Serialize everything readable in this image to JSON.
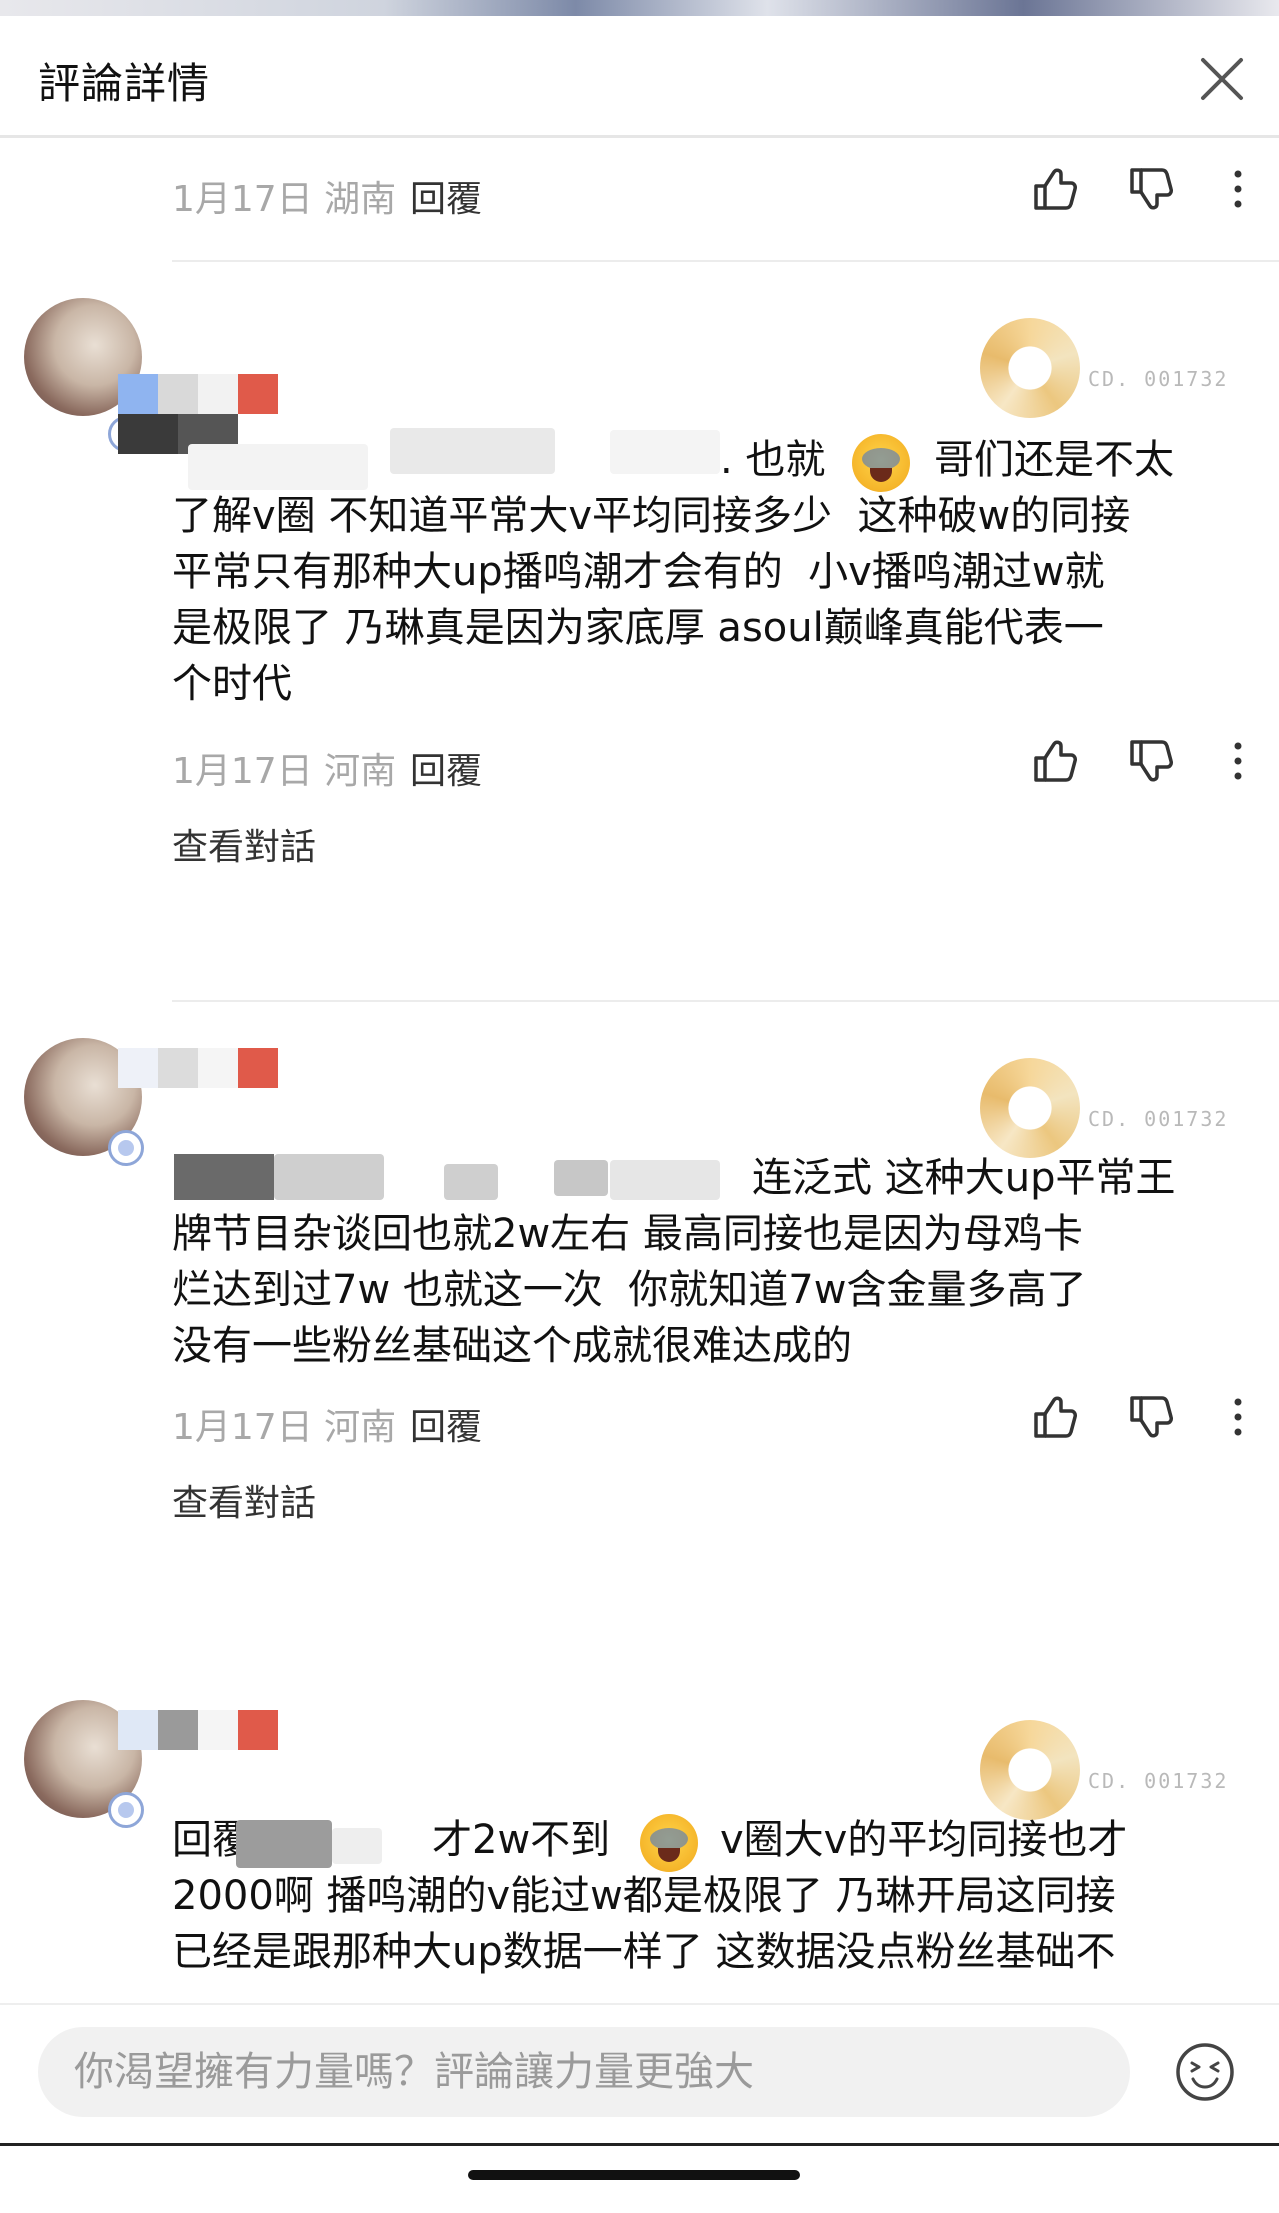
{
  "header": {
    "title": "評論詳情"
  },
  "top_meta": {
    "date": "1月17日",
    "location": "湖南",
    "reply": "回覆"
  },
  "comments": [
    {
      "text_line1_tail": ". 也就",
      "text_line1_after_emoji": "哥们还是不太",
      "text_rest": "了解v圈 不知道平常大v平均同接多少  这种破w的同接\n平常只有那种大up播鸣潮才会有的  小v播鸣潮过w就\n是极限了 乃琳真是因为家底厚 asoul巅峰真能代表一\n个时代",
      "date": "1月17日",
      "location": "河南",
      "reply": "回覆",
      "view_conversation": "查看對話",
      "pendant_code": "CD.\n001732"
    },
    {
      "text_line1_tail": "连泛式 这种大up平常王",
      "text_rest": "牌节目杂谈回也就2w左右 最高同接也是因为母鸡卡\n烂达到过7w 也就这一次  你就知道7w含金量多高了\n没有一些粉丝基础这个成就很难达成的",
      "date": "1月17日",
      "location": "河南",
      "reply": "回覆",
      "view_conversation": "查看對話",
      "pendant_code": "CD.\n001732"
    },
    {
      "text_line1_head": "回覆",
      "text_line1_mid": "才2w不到",
      "text_line1_after_emoji": "v圈大v的平均同接也才",
      "text_rest": "2000啊 播鸣潮的v能过w都是极限了 乃琳开局这同接\n已经是跟那种大up数据一样了 这数据没点粉丝基础不",
      "pendant_code": "CD.\n001732"
    }
  ],
  "input": {
    "placeholder": "你渴望擁有力量嗎？評論讓力量更強大"
  },
  "icons": {
    "close": "close-icon",
    "like": "thumb-up-icon",
    "dislike": "thumb-down-icon",
    "more": "more-vertical-icon",
    "emoji": "emoji-icon"
  },
  "colors": {
    "meta_text": "#a8a8a8",
    "body_text": "#111111",
    "input_bg": "#f1f1f1"
  }
}
